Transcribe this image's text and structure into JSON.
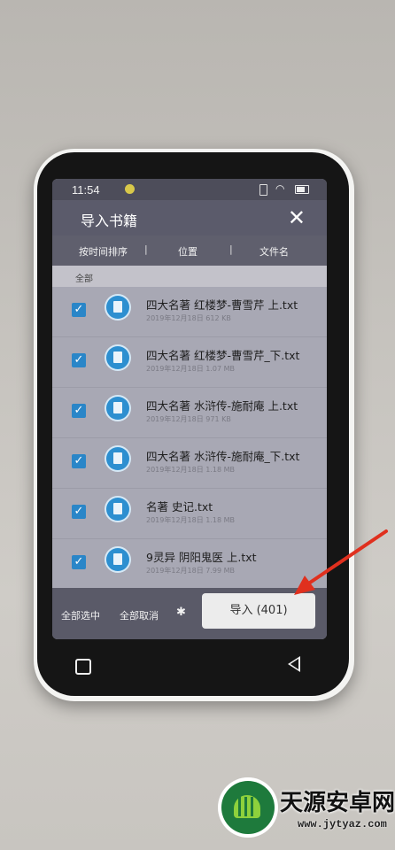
{
  "status": {
    "time": "11:54"
  },
  "header": {
    "title": "导入书籍",
    "close": "✕"
  },
  "sort": {
    "time": "按时间排序",
    "divider": "|",
    "location": "位置",
    "filename": "文件名"
  },
  "section": {
    "label": "全部"
  },
  "files": [
    {
      "name": "四大名著 红楼梦-曹雪芹 上.txt",
      "meta": "2019年12月18日 612 KB",
      "checked": true
    },
    {
      "name": "四大名著 红楼梦-曹雪芹_下.txt",
      "meta": "2019年12月18日 1.07 MB",
      "checked": true
    },
    {
      "name": "四大名著 水浒传-施耐庵 上.txt",
      "meta": "2019年12月18日 971 KB",
      "checked": true
    },
    {
      "name": "四大名著 水浒传-施耐庵_下.txt",
      "meta": "2019年12月18日 1.18 MB",
      "checked": true
    },
    {
      "name": "名著 史记.txt",
      "meta": "2019年12月18日 1.18 MB",
      "checked": true
    },
    {
      "name": "9灵异 阴阳鬼医 上.txt",
      "meta": "2019年12月18日 7.99 MB",
      "checked": true
    }
  ],
  "bottom": {
    "select_all": "全部选中",
    "deselect_all": "全部取消",
    "settings_icon": "gear-icon",
    "import": "导入 (401)"
  },
  "watermark": {
    "title": "天源安卓网",
    "url": "www.jytyaz.com"
  },
  "colors": {
    "accent": "#2a86c8",
    "arrow": "#e0301e"
  }
}
